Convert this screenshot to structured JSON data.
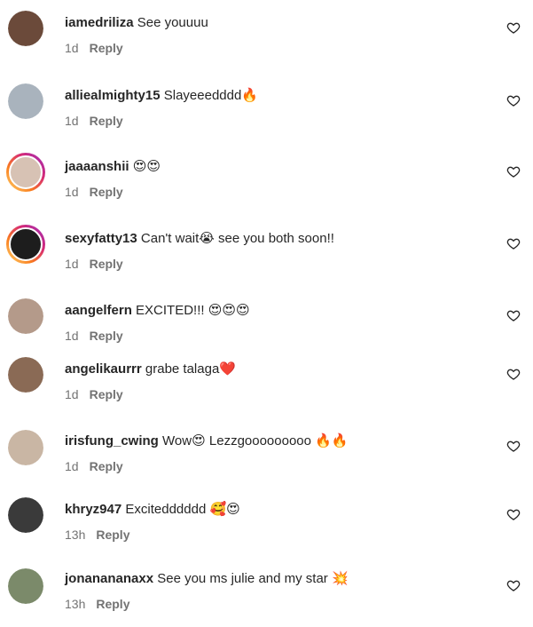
{
  "comments": [
    {
      "username": "iamedriliza",
      "text": "See youuuu",
      "time": "1d",
      "reply": "Reply",
      "avatar_color": "#6b4a3a",
      "ring": ""
    },
    {
      "username": "alliealmighty15",
      "text": "Slayeeedddd🔥",
      "time": "1d",
      "reply": "Reply",
      "avatar_color": "#a9b3bd",
      "ring": ""
    },
    {
      "username": "jaaaanshii",
      "text": "😍😍",
      "time": "1d",
      "reply": "Reply",
      "avatar_color": "#d7c2b4",
      "ring": "#d62976"
    },
    {
      "username": "sexyfatty13",
      "text": "Can't wait😭 see you both soon!!",
      "time": "1d",
      "reply": "Reply",
      "avatar_color": "#1d1d1d",
      "ring": "#d62976"
    },
    {
      "username": "aangelfern",
      "text": "EXCITED!!! 😍😍😍",
      "time": "1d",
      "reply": "Reply",
      "avatar_color": "#b49a8a",
      "ring": ""
    },
    {
      "username": "angelikaurrr",
      "text": "grabe talaga❤️",
      "time": "1d",
      "reply": "Reply",
      "avatar_color": "#8a6a55",
      "ring": ""
    },
    {
      "username": "irisfung_cwing",
      "text": "Wow😍 Lezzgooooooooo 🔥🔥",
      "time": "1d",
      "reply": "Reply",
      "avatar_color": "#c9b6a4",
      "ring": ""
    },
    {
      "username": "khryz947",
      "text": "Excitedddddd 🥰😍",
      "time": "13h",
      "reply": "Reply",
      "avatar_color": "#3a3a3a",
      "ring": ""
    },
    {
      "username": "jonanananaxx",
      "text": "See you ms julie and my star 💥",
      "time": "13h",
      "reply": "Reply",
      "avatar_color": "#7b8a6a",
      "ring": ""
    }
  ],
  "icons": {
    "heart": "heart-outline-icon"
  }
}
